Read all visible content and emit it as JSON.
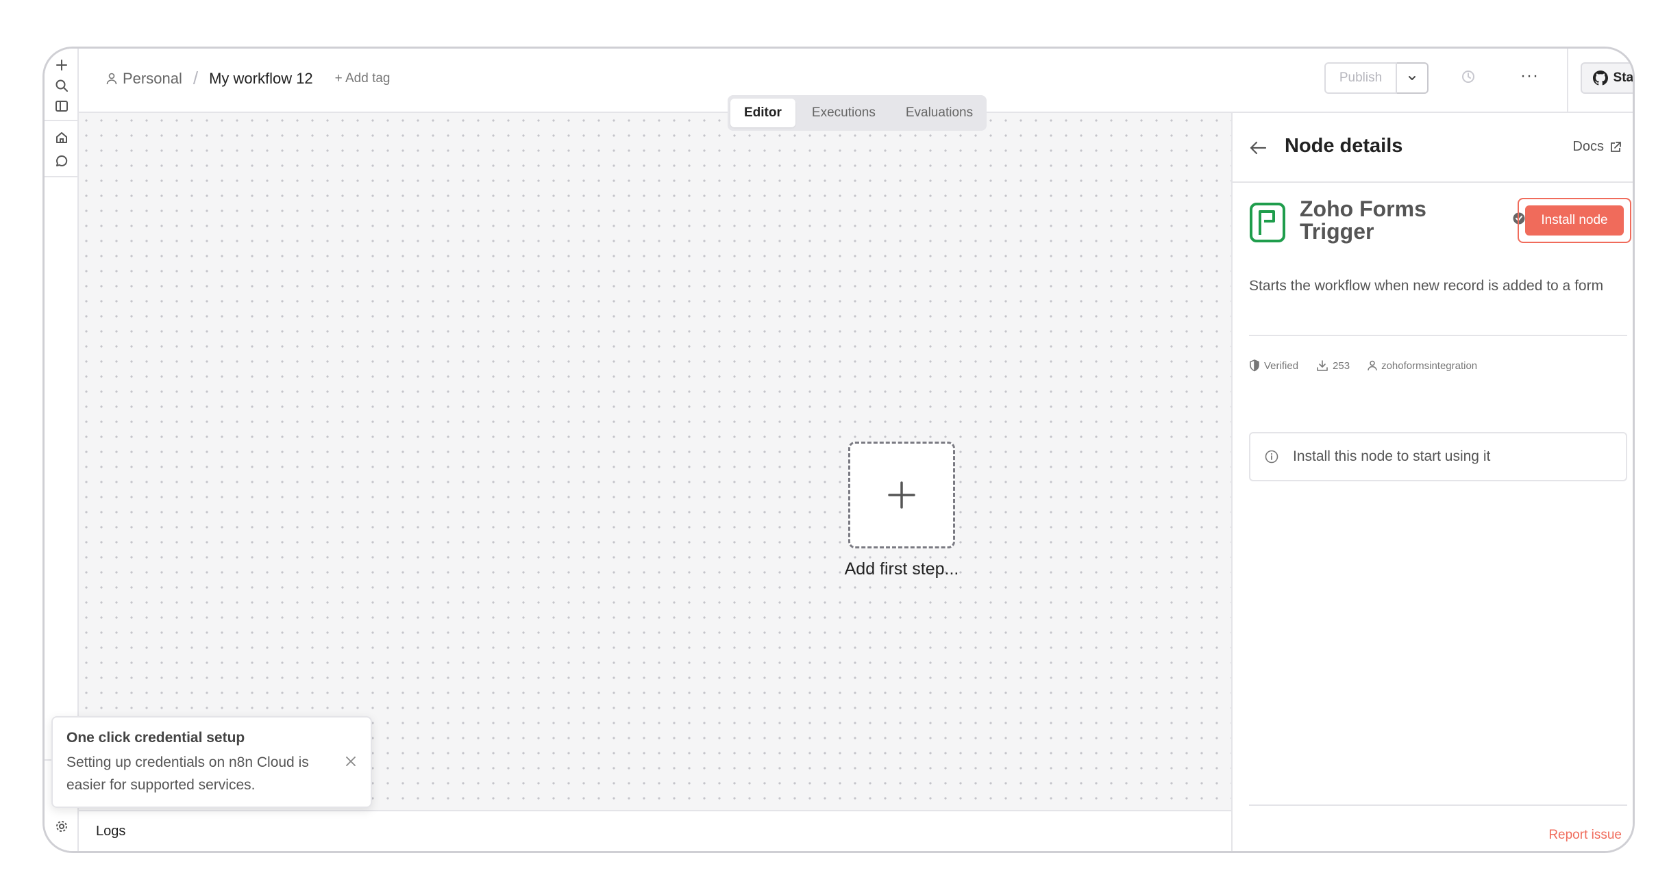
{
  "breadcrumb": {
    "personal": "Personal",
    "separator": "/",
    "workflow_name": "My workflow 12",
    "add_tag": "+ Add tag"
  },
  "header": {
    "publish_label": "Publish",
    "more_label": "···",
    "star_label": "Star"
  },
  "tabs": [
    {
      "label": "Editor",
      "active": true
    },
    {
      "label": "Executions",
      "active": false
    },
    {
      "label": "Evaluations",
      "active": false
    }
  ],
  "canvas": {
    "add_first_step": "Add first step..."
  },
  "logs": {
    "label": "Logs"
  },
  "toast": {
    "title": "One click credential setup",
    "body": "Setting up credentials on n8n Cloud is easier for supported services."
  },
  "panel": {
    "title": "Node details",
    "docs_label": "Docs",
    "node_name": "Zoho Forms Trigger",
    "install_label": "Install node",
    "description": "Starts the workflow when new record is added to a form",
    "meta": {
      "verified": "Verified",
      "downloads": "253",
      "author": "zohoformsintegration"
    },
    "info_text": "Install this node to start using it",
    "report_issue": "Report issue"
  },
  "colors": {
    "accent": "#f06b5b",
    "zoho_green": "#1f9d4c",
    "canvas_bg": "#f5f5f6"
  }
}
